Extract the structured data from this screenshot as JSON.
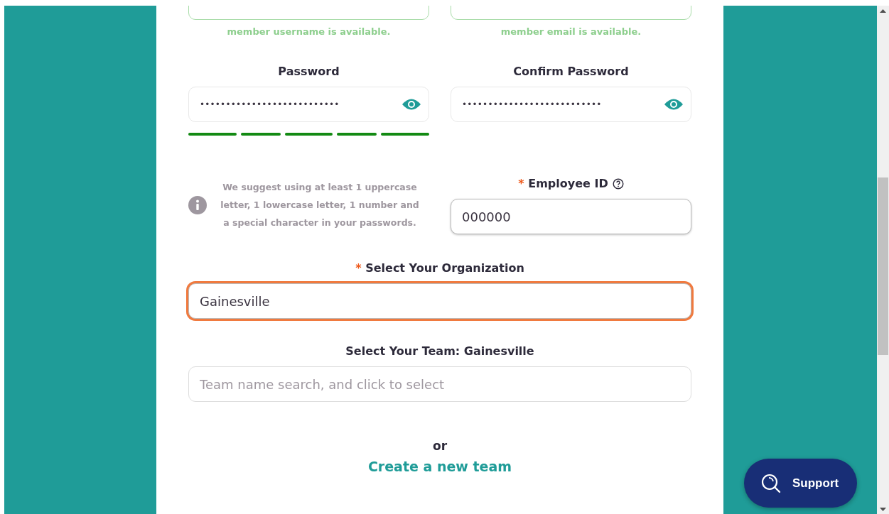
{
  "account_fields": [
    {
      "message": "member username is available."
    },
    {
      "message": "member email is available."
    }
  ],
  "password": {
    "label": "Password",
    "masked": "•••••••••••••••••••••••••••",
    "strength_segments": [
      {
        "on": true
      },
      {
        "on": true
      },
      {
        "on": true
      },
      {
        "on": true
      },
      {
        "on": true
      }
    ]
  },
  "confirm_password": {
    "label": "Confirm Password",
    "masked": "•••••••••••••••••••••••••••"
  },
  "password_hint": "We suggest using at least 1 uppercase letter, 1 lowercase letter, 1 number and a special character in your passwords.",
  "employee_id": {
    "required_mark": "*",
    "label": "Employee ID",
    "value": "000000"
  },
  "organization": {
    "required_mark": "*",
    "label": "Select Your Organization",
    "value": "Gainesville",
    "focused": true
  },
  "team": {
    "label": "Select Your Team: Gainesville",
    "placeholder": "Team name search, and click to select"
  },
  "separator": "or",
  "create_team_link": "Create a new team",
  "support_button": {
    "label": "Support"
  }
}
